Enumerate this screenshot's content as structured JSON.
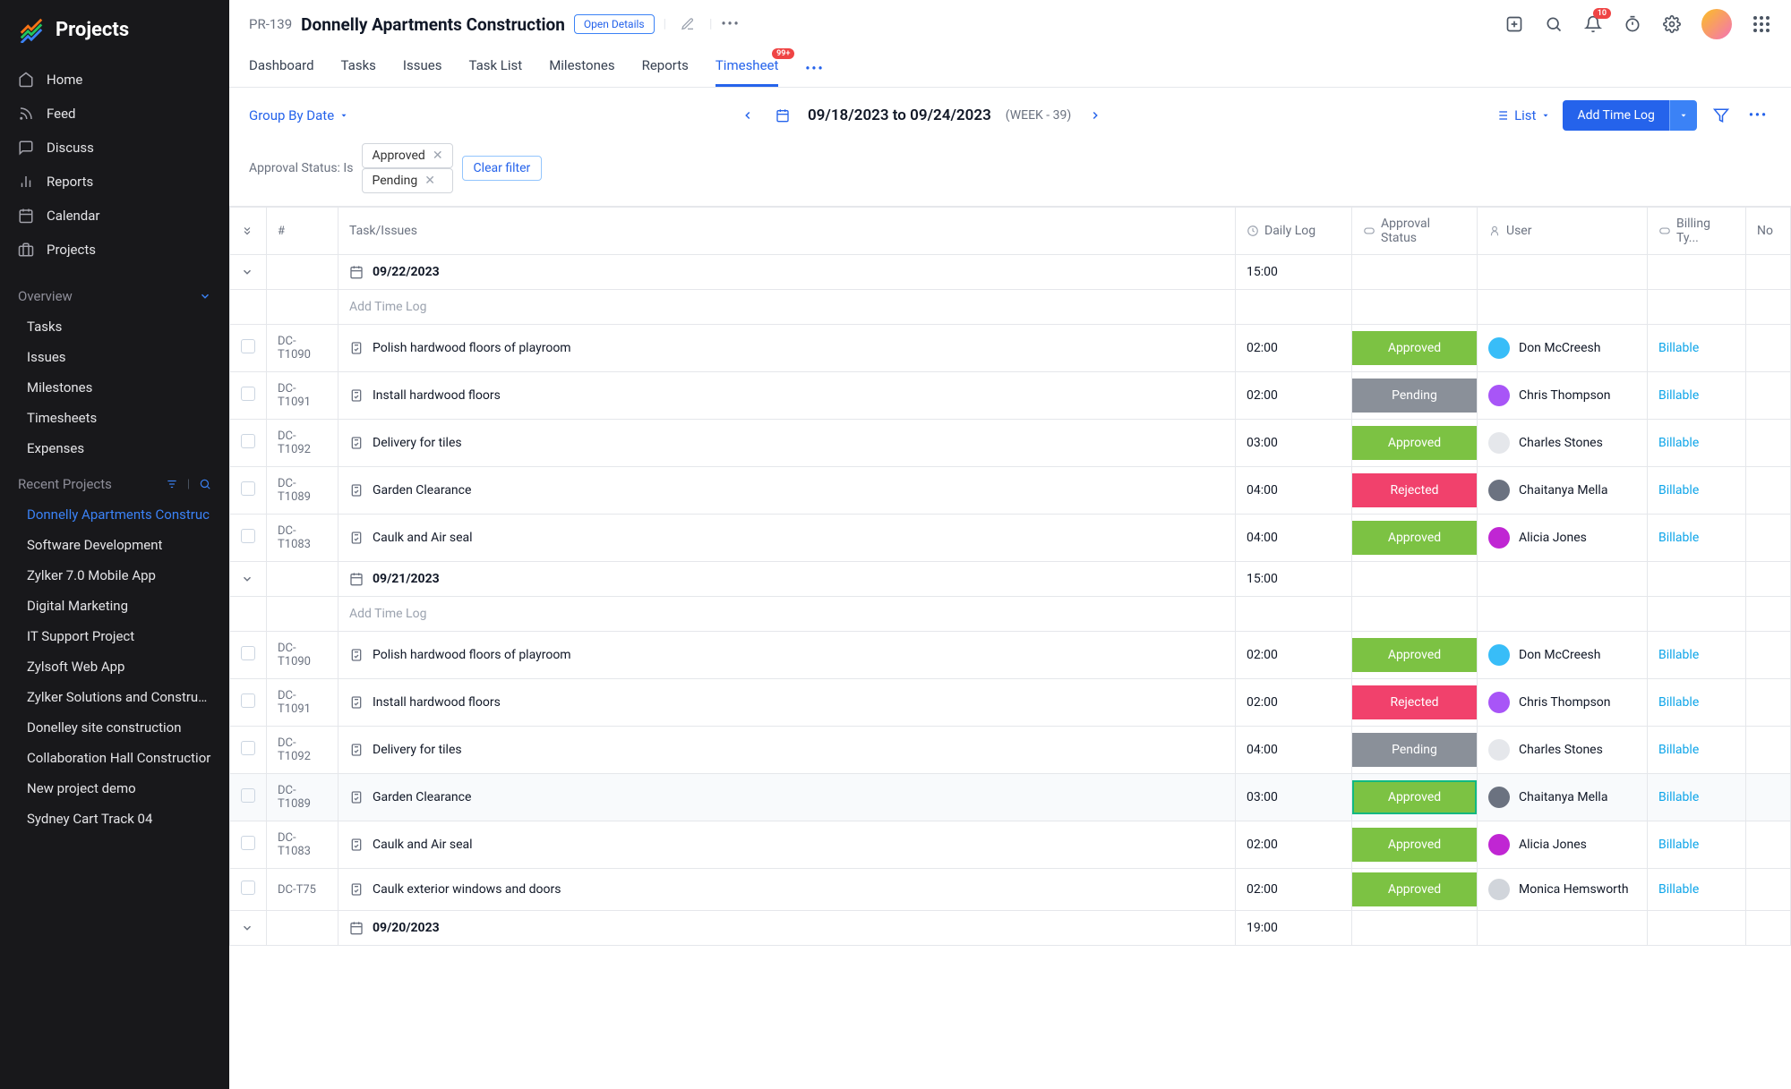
{
  "app": {
    "name": "Projects"
  },
  "sidebar": {
    "nav": [
      {
        "label": "Home",
        "icon": "home"
      },
      {
        "label": "Feed",
        "icon": "feed"
      },
      {
        "label": "Discuss",
        "icon": "discuss"
      },
      {
        "label": "Reports",
        "icon": "reports"
      },
      {
        "label": "Calendar",
        "icon": "calendar"
      },
      {
        "label": "Projects",
        "icon": "projects"
      }
    ],
    "overview": {
      "title": "Overview",
      "items": [
        "Tasks",
        "Issues",
        "Milestones",
        "Timesheets",
        "Expenses"
      ]
    },
    "recent": {
      "title": "Recent Projects",
      "items": [
        "Donnelly Apartments Construc",
        "Software Development",
        "Zylker 7.0 Mobile App",
        "Digital Marketing",
        "IT Support Project",
        "Zylsoft Web App",
        "Zylker Solutions and Constructi",
        "Donelley site construction",
        "Collaboration Hall Constructior",
        "New project demo",
        "Sydney Cart Track 04"
      ]
    }
  },
  "header": {
    "project_id": "PR-139",
    "project_name": "Donnelly Apartments Construction",
    "open_details": "Open Details",
    "notif_badge": "10",
    "tabs": [
      "Dashboard",
      "Tasks",
      "Issues",
      "Task List",
      "Milestones",
      "Reports",
      "Timesheet"
    ],
    "active_tab": "Timesheet",
    "timesheet_badge": "99+"
  },
  "toolbar": {
    "group_by": "Group By Date",
    "date_range": "09/18/2023 to 09/24/2023",
    "week_label": "(WEEK - 39)",
    "view_mode": "List",
    "add_btn": "Add Time Log"
  },
  "filter": {
    "label": "Approval Status: Is",
    "chips": [
      "Approved",
      "Pending"
    ],
    "clear": "Clear filter"
  },
  "columns": [
    "#",
    "Task/Issues",
    "Daily Log",
    "Approval Status",
    "User",
    "Billing Ty...",
    "No"
  ],
  "add_log_placeholder": "Add Time Log",
  "avatar_colors": {
    "Don McCreesh": "#38bdf8",
    "Chris Thompson": "#a855f7",
    "Charles Stones": "#e5e7eb",
    "Chaitanya Mella": "#6b7280",
    "Alicia Jones": "#c026d3",
    "Monica Hemsworth": "#d1d5db"
  },
  "groups": [
    {
      "date": "09/22/2023",
      "total": "15:00",
      "rows": [
        {
          "id": "DC-T1090",
          "task": "Polish hardwood floors of playroom",
          "log": "02:00",
          "status": "Approved",
          "user": "Don McCreesh",
          "billing": "Billable"
        },
        {
          "id": "DC-T1091",
          "task": "Install hardwood floors",
          "log": "02:00",
          "status": "Pending",
          "user": "Chris Thompson",
          "billing": "Billable"
        },
        {
          "id": "DC-T1092",
          "task": "Delivery for tiles",
          "log": "03:00",
          "status": "Approved",
          "user": "Charles Stones",
          "billing": "Billable"
        },
        {
          "id": "DC-T1089",
          "task": "Garden Clearance",
          "log": "04:00",
          "status": "Rejected",
          "user": "Chaitanya Mella",
          "billing": "Billable"
        },
        {
          "id": "DC-T1083",
          "task": "Caulk and Air seal",
          "log": "04:00",
          "status": "Approved",
          "user": "Alicia Jones",
          "billing": "Billable"
        }
      ]
    },
    {
      "date": "09/21/2023",
      "total": "15:00",
      "rows": [
        {
          "id": "DC-T1090",
          "task": "Polish hardwood floors of playroom",
          "log": "02:00",
          "status": "Approved",
          "user": "Don McCreesh",
          "billing": "Billable"
        },
        {
          "id": "DC-T1091",
          "task": "Install hardwood floors",
          "log": "02:00",
          "status": "Rejected",
          "user": "Chris Thompson",
          "billing": "Billable"
        },
        {
          "id": "DC-T1092",
          "task": "Delivery for tiles",
          "log": "04:00",
          "status": "Pending",
          "user": "Charles Stones",
          "billing": "Billable"
        },
        {
          "id": "DC-T1089",
          "task": "Garden Clearance",
          "log": "03:00",
          "status": "Approved",
          "user": "Chaitanya Mella",
          "billing": "Billable",
          "highlight": true
        },
        {
          "id": "DC-T1083",
          "task": "Caulk and Air seal",
          "log": "02:00",
          "status": "Approved",
          "user": "Alicia Jones",
          "billing": "Billable"
        },
        {
          "id": "DC-T75",
          "task": "Caulk exterior windows and doors",
          "log": "02:00",
          "status": "Approved",
          "user": "Monica Hemsworth",
          "billing": "Billable"
        }
      ]
    },
    {
      "date": "09/20/2023",
      "total": "19:00",
      "rows": []
    }
  ]
}
